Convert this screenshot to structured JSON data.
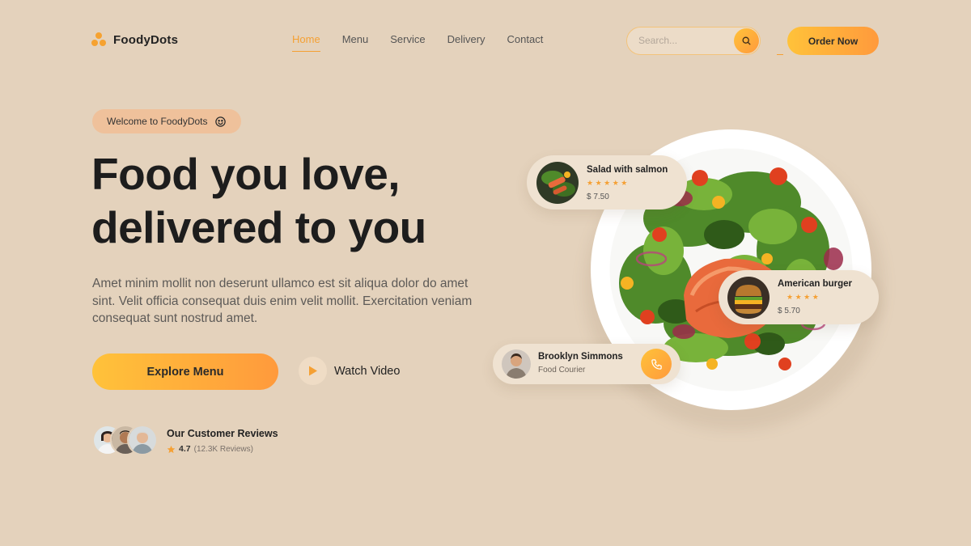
{
  "brand": {
    "name": "FoodyDots"
  },
  "nav": {
    "items": [
      {
        "label": "Home",
        "active": true
      },
      {
        "label": "Menu",
        "active": false
      },
      {
        "label": "Service",
        "active": false
      },
      {
        "label": "Delivery",
        "active": false
      },
      {
        "label": "Contact",
        "active": false
      }
    ]
  },
  "search": {
    "placeholder": "Search...",
    "icon": "search-icon"
  },
  "header": {
    "order_label": "Order Now"
  },
  "hero": {
    "welcome": "Welcome to FoodyDots",
    "welcome_icon": "smiley-icon",
    "title_line1": "Food you love,",
    "title_line2": "delivered to you",
    "description": "Amet minim mollit non deserunt ullamco est sit aliqua dolor do amet sint. Velit officia consequat duis enim velit mollit. Exercitation veniam consequat sunt nostrud amet.",
    "explore_label": "Explore Menu",
    "watch_label": "Watch Video"
  },
  "reviews": {
    "title": "Our Customer Reviews",
    "rating": "4.7",
    "count": "(12.3K Reviews)"
  },
  "cards": {
    "salmon": {
      "title": "Salad with salmon",
      "stars": "★★★★★",
      "price": "$ 7.50"
    },
    "burger": {
      "title": "American burger",
      "stars": "★★★★",
      "price": "$ 5.70"
    },
    "courier": {
      "name": "Brooklyn Simmons",
      "role": "Food Courier"
    }
  },
  "colors": {
    "background": "#e4d2bc",
    "accent": "#f5a033",
    "gradient_start": "#ffc23a",
    "gradient_end": "#ff9a3c",
    "card": "#efe2d1"
  }
}
